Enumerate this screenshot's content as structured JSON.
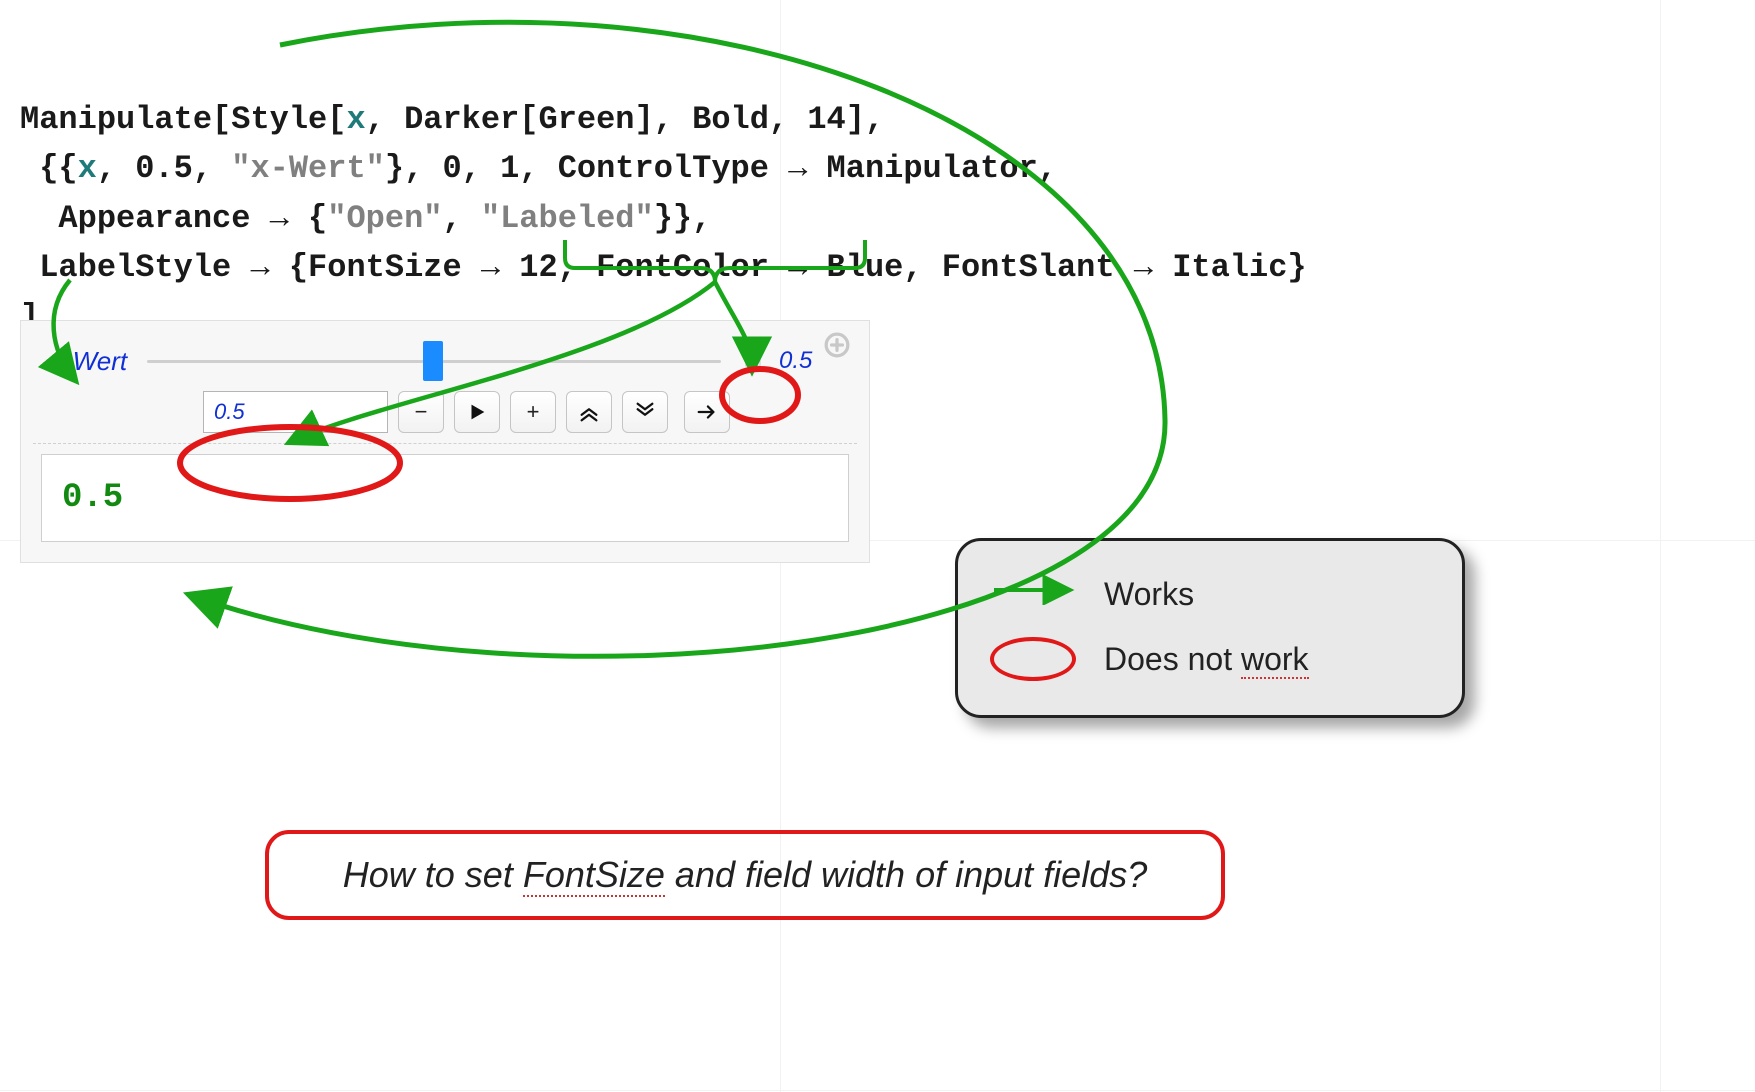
{
  "code": {
    "line1_a": "Manipulate[Style[",
    "line1_x": "x",
    "line1_b": ", Darker[Green], Bold, 14],",
    "line2_a": " {{",
    "line2_x": "x",
    "line2_b": ", 0.5, ",
    "line2_str": "\"x-Wert\"",
    "line2_c": "}, 0, 1, ControlType ",
    "line2_arr": "→",
    "line2_d": " Manipulator,",
    "line3_a": "  Appearance ",
    "line3_arr": "→",
    "line3_b": " {",
    "line3_str1": "\"Open\"",
    "line3_c": ", ",
    "line3_str2": "\"Labeled\"",
    "line3_d": "}},",
    "line4_a": " LabelStyle ",
    "line4_arr1": "→",
    "line4_b": " {FontSize ",
    "line4_arr2": "→",
    "line4_c": " 12, FontColor ",
    "line4_arr3": "→",
    "line4_d": " Blue, FontSlant ",
    "line4_arr4": "→",
    "line4_e": " Italic}",
    "line5": "]"
  },
  "manip": {
    "label": "x-Wert",
    "slider_label_value": "0.5",
    "input_value": "0.5",
    "output_value": "0.5"
  },
  "legend": {
    "works": "Works",
    "not_works_a": "Does not ",
    "not_works_b": "work"
  },
  "question": {
    "t1": "How to set ",
    "t2": "FontSize",
    "t3": " and field width of input fields?"
  }
}
